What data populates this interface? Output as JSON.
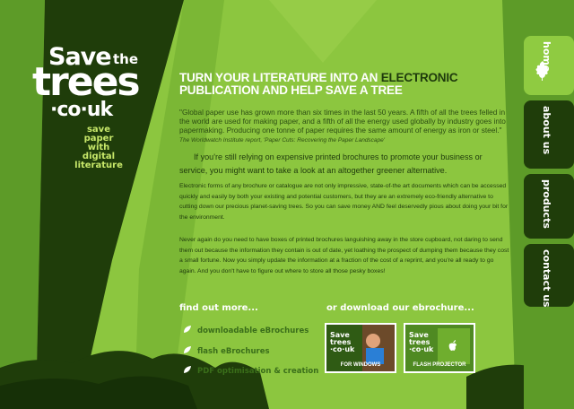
{
  "colors": {
    "page_green": "#8cc63f",
    "dark_green": "#1e3a0c",
    "mid_green": "#3a6e1a",
    "nav_dark": "#1f3d0a",
    "nav_active": "#8fcb41"
  },
  "logo": {
    "save": "Save",
    "the": "the",
    "trees": "trees",
    "couk": "·co·uk"
  },
  "tagline": [
    "save",
    "paper",
    "with",
    "digital",
    "literature"
  ],
  "headline": {
    "part1": "Turn your literature into an ",
    "highlight": "electronic",
    "part2": " publication and help save a tree"
  },
  "quote": {
    "text": "\"Global paper use has grown more than six times in the last 50 years. A fifth of all the trees felled in the world are used for making paper, and a fifth of all the energy used globally by industry goes into papermaking. Producing one tonne of paper requires the same amount of energy as iron or steel.\"",
    "cite": "The Worldwatch Institute report, 'Paper Cuts: Recovering the Paper Landscape'"
  },
  "lead": "If you're still relying on expensive printed brochures to promote your business or service, you might want to take a look at an altogether greener alternative.",
  "paragraphs": [
    "Electronic forms of any brochure or catalogue are not only impressive, state-of-the art documents which can be accessed quickly and easily by both your existing and potential customers, but they are an extremely eco-friendly alternative to cutting down our precious planet-saving trees. So you can save money AND feel deservedly pious about doing your bit for the environment.",
    "Never again do you need to have boxes of printed brochures languishing away in the store cupboard, not daring to send them out because the information they contain is out of date, yet loathing the prospect of dumping them because they cost a small fortune. Now you simply update the information at a fraction of the cost of a reprint, and you're all ready to go again. And you don't have to figure out where to store all those pesky boxes!"
  ],
  "find_more": {
    "heading": "find out more...",
    "links": [
      "downloadable eBrochures",
      "flash eBrochures",
      "PDF optimisation & creation"
    ]
  },
  "download": {
    "heading": "or download our ebrochure...",
    "windows_label": "FOR WINDOWS",
    "mac_label": "FLASH PROJECTOR"
  },
  "nav": {
    "home": "home",
    "about": "about us",
    "products": "products",
    "contact": "contact us"
  }
}
